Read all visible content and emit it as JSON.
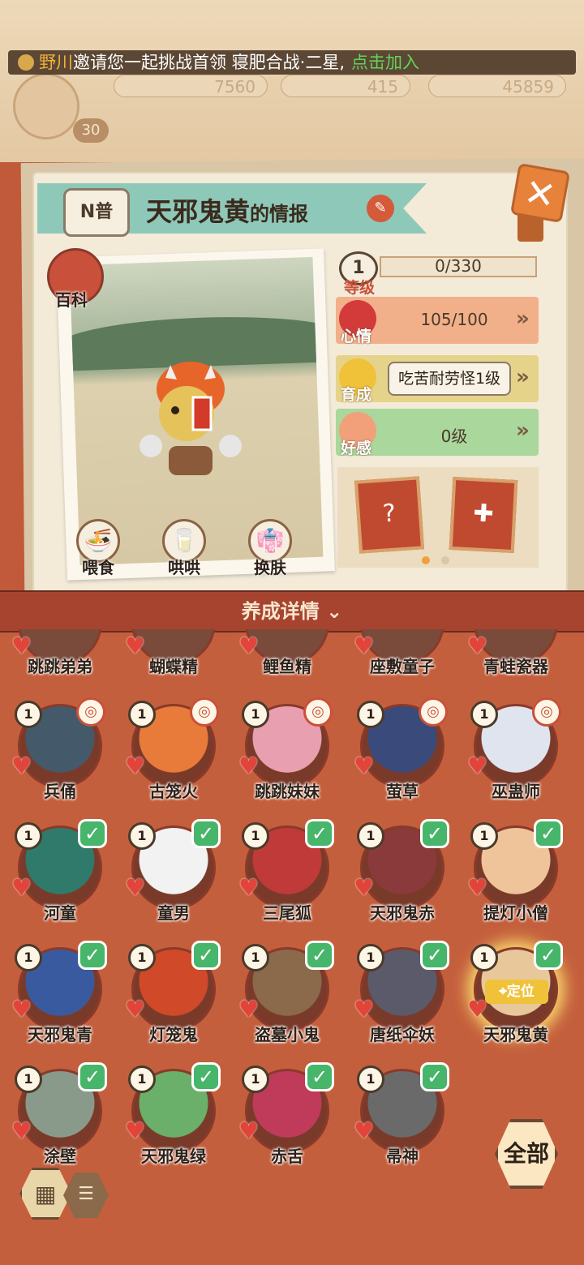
{
  "invite": {
    "player": "野川",
    "message": "邀请您一起挑战首领 寝肥合战·二星,",
    "join": "点击加入"
  },
  "resources": {
    "res1": "7560",
    "res2": "415",
    "res3": "45859",
    "player_level": "30"
  },
  "info": {
    "rarity": "N普",
    "name": "天邪鬼黄",
    "title_suffix": "的情报",
    "encyclopedia": "百科",
    "level_label": "等级",
    "level_value": "1",
    "exp": "0/330",
    "mood_label": "心情",
    "mood_value": "105/100",
    "growth_label": "育成",
    "growth_value": "吃苦耐劳怪1级",
    "affection_label": "好感",
    "affection_value": "0级",
    "actions": [
      "喂食",
      "哄哄",
      "换肤"
    ]
  },
  "details_bar": "养成详情",
  "partial_row": [
    "跳跳弟弟",
    "蝴蝶精",
    "鲤鱼精",
    "座敷童子",
    "青蛙瓷器"
  ],
  "roster": [
    {
      "name": "兵俑",
      "level": "1",
      "color": "#445a6a",
      "tag": "food"
    },
    {
      "name": "古笼火",
      "level": "1",
      "color": "#e87a3a",
      "tag": "food"
    },
    {
      "name": "跳跳妹妹",
      "level": "1",
      "color": "#e8a0b0",
      "tag": "food"
    },
    {
      "name": "萤草",
      "level": "1",
      "color": "#3a4a7a",
      "tag": "food"
    },
    {
      "name": "巫蛊师",
      "level": "1",
      "color": "#dfe4ee",
      "tag": "food"
    },
    {
      "name": "河童",
      "level": "1",
      "color": "#2f7a6a",
      "tag": "check"
    },
    {
      "name": "童男",
      "level": "1",
      "color": "#f2f2f2",
      "tag": "check"
    },
    {
      "name": "三尾狐",
      "level": "1",
      "color": "#c03a3a",
      "tag": "check"
    },
    {
      "name": "天邪鬼赤",
      "level": "1",
      "color": "#8a3a3a",
      "tag": "check"
    },
    {
      "name": "提灯小僧",
      "level": "1",
      "color": "#f0c49a",
      "tag": "check"
    },
    {
      "name": "天邪鬼青",
      "level": "1",
      "color": "#3a5aa0",
      "tag": "check"
    },
    {
      "name": "灯笼鬼",
      "level": "1",
      "color": "#d04a2a",
      "tag": "check"
    },
    {
      "name": "盗墓小鬼",
      "level": "1",
      "color": "#8a6a4a",
      "tag": "check"
    },
    {
      "name": "唐纸伞妖",
      "level": "1",
      "color": "#5a5a6a",
      "tag": "check"
    },
    {
      "name": "天邪鬼黄",
      "level": "1",
      "color": "#e8c89a",
      "tag": "check",
      "locate": "定位"
    },
    {
      "name": "涂壁",
      "level": "1",
      "color": "#8a9a8a",
      "tag": "check"
    },
    {
      "name": "天邪鬼绿",
      "level": "1",
      "color": "#6ab06a",
      "tag": "check"
    },
    {
      "name": "赤舌",
      "level": "1",
      "color": "#c03a5a",
      "tag": "check"
    },
    {
      "name": "帚神",
      "level": "1",
      "color": "#6a6a6a",
      "tag": "check"
    }
  ],
  "all_button": "全部",
  "icons": {
    "heart": "heart-icon",
    "check": "checkmark-icon",
    "grid": "grid-view-icon",
    "list": "list-view-icon"
  }
}
